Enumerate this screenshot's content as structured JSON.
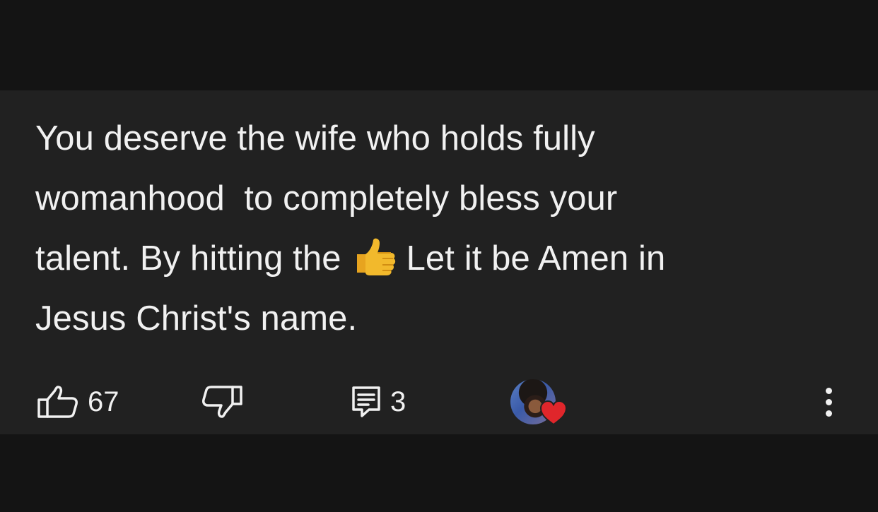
{
  "comment": {
    "line1": "You deserve the wife who holds fully",
    "line2": "womanhood  to completely bless your",
    "line3_before_emoji": "talent. By hitting the",
    "emoji": "thumbs-up-emoji",
    "line3_after_emoji": "Let it be Amen in",
    "line4": "Jesus Christ's name."
  },
  "actions": {
    "like_icon": "thumbs-up-icon",
    "like_count": "67",
    "dislike_icon": "thumbs-down-icon",
    "reply_icon": "comment-reply-icon",
    "reply_count": "3",
    "creator_heart_icon": "heart-icon",
    "more_icon": "more-vertical-icon"
  },
  "colors": {
    "page_background": "#141414",
    "card_background": "#212121",
    "text": "#f1f1f1",
    "heart": "#e0262b",
    "emoji_yellow": "#f2b92c"
  }
}
